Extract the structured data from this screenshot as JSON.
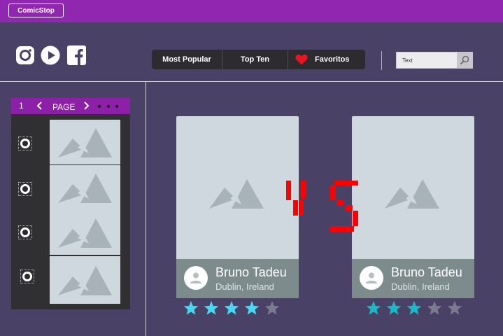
{
  "header": {
    "brand_label": "ComicStop"
  },
  "social": [
    "instagram-icon",
    "play-icon",
    "facebook-icon"
  ],
  "nav": {
    "items": [
      "Most Popular",
      "Top Ten",
      "Favoritos"
    ]
  },
  "search": {
    "placeholder": "Text"
  },
  "sidebar": {
    "pager": {
      "page_number": "1",
      "label": "PAGE"
    },
    "rows": 4
  },
  "cards": [
    {
      "name": "Bruno Tadeu",
      "location": "Dublin, Ireland",
      "rating": 4,
      "max_rating": 5
    },
    {
      "name": "Bruno Tadeu",
      "location": "Dublin, Ireland",
      "rating": 3,
      "max_rating": 5
    }
  ],
  "versus": {
    "label": "VS"
  },
  "colors": {
    "background": "#4a4166",
    "topbar": "#9127b0",
    "star_active_left": "#45d8f3",
    "star_active_right": "#19bac5",
    "star_inactive": "#7c7a8e",
    "vs_color": "#ff0000",
    "heart": "#e8141e"
  }
}
